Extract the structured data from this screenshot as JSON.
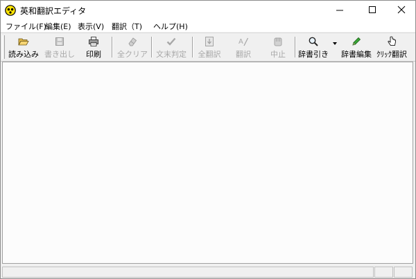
{
  "window": {
    "title": "英和翻訳エディタ"
  },
  "menu": {
    "items": [
      {
        "label": "ファイル(F)"
      },
      {
        "label": "編集(E)"
      },
      {
        "label": "表示(V)"
      },
      {
        "label": "翻訳（T)"
      },
      {
        "label": "ヘルプ(H)"
      }
    ]
  },
  "toolbar": {
    "buttons": [
      {
        "label": "読み込み",
        "icon": "folder-open-icon",
        "enabled": true
      },
      {
        "label": "書き出し",
        "icon": "floppy-disk-icon",
        "enabled": false
      },
      {
        "label": "印刷",
        "icon": "printer-icon",
        "enabled": true
      },
      {
        "label": "全クリア",
        "icon": "eraser-icon",
        "enabled": false
      },
      {
        "label": "文末判定",
        "icon": "check-icon",
        "enabled": false
      },
      {
        "label": "全翻訳",
        "icon": "translate-all-icon",
        "enabled": false
      },
      {
        "label": "翻訳",
        "icon": "translate-icon",
        "enabled": false
      },
      {
        "label": "中止",
        "icon": "stop-hand-icon",
        "enabled": false
      },
      {
        "label": "辞書引き",
        "icon": "magnifier-icon",
        "enabled": true
      },
      {
        "label": "辞書編集",
        "icon": "pencil-icon",
        "enabled": true
      },
      {
        "label": "ｸﾘｯｸ翻訳",
        "icon": "hand-pointer-icon",
        "enabled": true
      }
    ]
  },
  "editor": {
    "text": ""
  },
  "status": {
    "main": ""
  }
}
